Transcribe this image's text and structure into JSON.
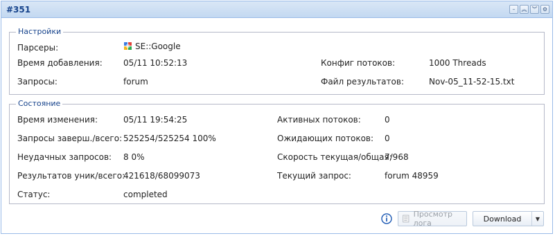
{
  "panel": {
    "title": "#351"
  },
  "settings": {
    "legend": "Настройки",
    "parsers_label": "Парсеры:",
    "parsers_value": "SE::Google",
    "added_label": "Время добавления:",
    "added_value": "05/11 10:52:13",
    "threads_config_label": "Конфиг потоков:",
    "threads_config_value": "1000 Threads",
    "queries_label": "Запросы:",
    "queries_value": "forum",
    "results_file_label": "Файл результатов:",
    "results_file_value": "Nov-05_11-52-15.txt"
  },
  "state": {
    "legend": "Состояние",
    "changed_label": "Время изменения:",
    "changed_value": "05/11 19:54:25",
    "active_threads_label": "Активных потоков:",
    "active_threads_value": "0",
    "queries_done_label": "Запросы заверш./всего:",
    "queries_done_value": "525254/525254 100%",
    "waiting_threads_label": "Ожидающих потоков:",
    "waiting_threads_value": "0",
    "failed_label": "Неудачных запросов:",
    "failed_value": "8 0%",
    "speed_label": "Скорость текущая/общая:",
    "speed_value": "7/968",
    "results_label": "Результатов уник/всего:",
    "results_value": "421618/68099073",
    "current_query_label": "Текущий запрос:",
    "current_query_value": "forum 48959",
    "status_label": "Статус:",
    "status_value": "completed"
  },
  "buttons": {
    "view_log": "Просмотр лога",
    "download": "Download"
  },
  "icons": {
    "parser": "google-icon",
    "info": "info-icon",
    "log": "log-icon"
  },
  "colors": {
    "header_bg": "#dae7f6",
    "title": "#15428b",
    "border": "#99bbe8"
  }
}
